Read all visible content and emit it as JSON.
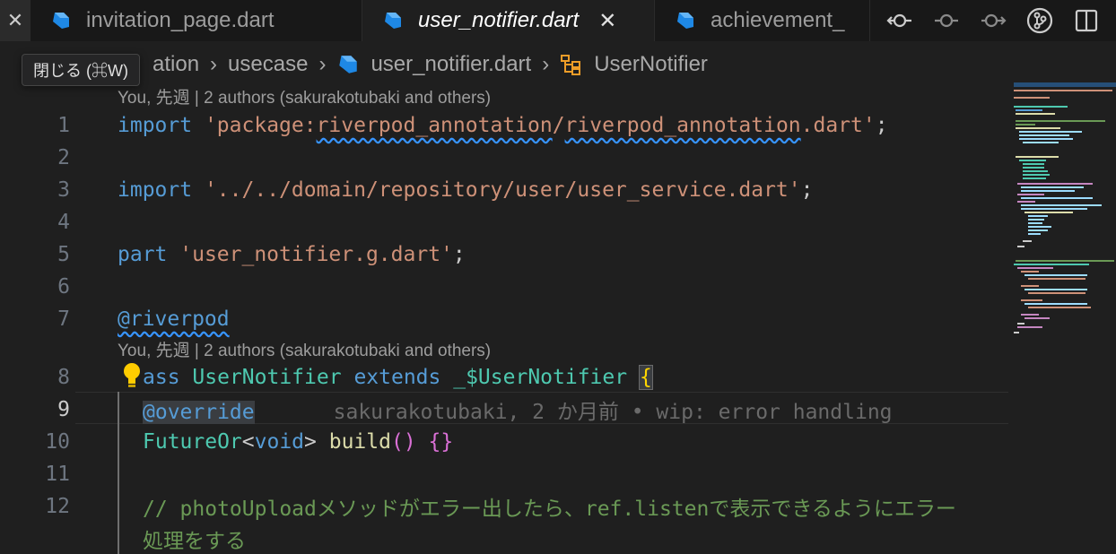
{
  "tabs": [
    {
      "label": "invitation_page.dart",
      "active": false
    },
    {
      "label": "user_notifier.dart",
      "active": true
    },
    {
      "label": "achievement_",
      "active": false
    }
  ],
  "tab_close_glyph": "✕",
  "tooltip": "閉じる (⌘W)",
  "breadcrumb": [
    "ation",
    "usecase",
    "user_notifier.dart",
    "UserNotifier"
  ],
  "codelens": "You, 先週 | 2 authors (sakurakotubaki and others)",
  "lines": {
    "n1": "1",
    "n2": "2",
    "n3": "3",
    "n4": "4",
    "n5": "5",
    "n6": "6",
    "n7": "7",
    "n8": "8",
    "n9": "9",
    "n10": "10",
    "n11": "11",
    "n12": "12"
  },
  "code": {
    "l1_kw": "import",
    "l1_str_a": "'package:",
    "l1_str_b": "riverpod_annotation",
    "l1_str_c": "/",
    "l1_str_d": "riverpod_annotation",
    "l1_str_e": ".dart'",
    "l3_kw": "import",
    "l3_str": "'../../domain/repository/user/user_service.dart'",
    "l5_kw": "part",
    "l5_str": "'user_notifier.g.dart'",
    "l7_ann": "@riverpod",
    "l8_kw1": "ass",
    "l8_ty1": "UserNotifier",
    "l8_kw2": "extends",
    "l8_ty2": "_$UserNotifier",
    "l8_brace": "{",
    "l9_ann": "@override",
    "l9_blame": "sakurakotubaki, 2 か月前 • wip: error handling",
    "l10_ty1": "FutureOr",
    "l10_kw": "void",
    "l10_fn": "build",
    "l12_cm": "// photoUploadメソッドがエラー出したら、ref.listenで表示できるようにエラー",
    "l12_cm2": "処理をする"
  },
  "colors": {
    "background": "#1f1f1f",
    "keyword": "#569cd6",
    "string": "#ce9178",
    "type": "#4ec9b0",
    "function": "#dcdcaa",
    "comment": "#6a9955",
    "dart_blue": "#1e88e5"
  },
  "icons": [
    "dart-icon",
    "close-icon",
    "git-compare-icon",
    "git-commit-icon",
    "git-forward-icon",
    "source-control-icon",
    "split-editor-icon",
    "symbol-class-icon",
    "lightbulb-icon"
  ]
}
